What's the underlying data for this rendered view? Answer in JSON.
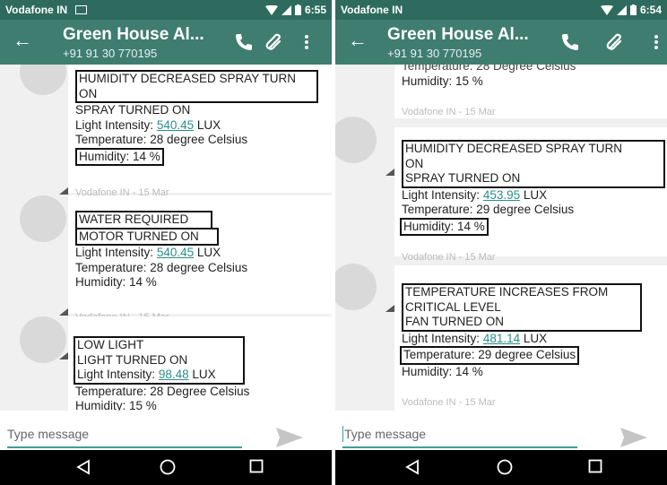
{
  "left": {
    "status": {
      "carrier": "Vodafone IN",
      "time": "6:55"
    },
    "appbar": {
      "title": "Green House Al...",
      "subtitle": "+91 91 30 770195"
    },
    "messages": [
      {
        "alert": [
          "HUMIDITY DECREASED SPRAY TURN",
          "ON"
        ],
        "lines": [
          "SPRAY TURNED ON"
        ],
        "light_value": "540.45",
        "temperature": "Temperature: 28 degree Celsius",
        "humidity": "Humidity: 14 %",
        "time": "Vodafone IN - 15 Mar"
      },
      {
        "alert": [
          "WATER REQUIRED",
          "MOTOR TURNED ON"
        ],
        "light_value": "540.45",
        "temperature": "Temperature: 28 degree Celsius",
        "humidity": "Humidity: 14 %",
        "time": "Vodafone IN - 15 Mar"
      },
      {
        "alert": [
          "LOW LIGHT",
          "LIGHT TURNED ON"
        ],
        "light_value": "98.48",
        "temperature": "Temperature: 28 Degree Celsius",
        "humidity": "Humidity: 15 %"
      }
    ],
    "compose_placeholder": "Type message"
  },
  "right": {
    "status": {
      "carrier": "Vodafone IN",
      "time": "6:54"
    },
    "appbar": {
      "title": "Green House Al...",
      "subtitle": "+91 91 30 770195"
    },
    "partial": {
      "temperature": "Temperature: 28 Degree Celsius",
      "humidity": "Humidity: 15 %",
      "time": "Vodafone IN - 15 Mar"
    },
    "messages": [
      {
        "alert": [
          "HUMIDITY DECREASED SPRAY TURN",
          "ON"
        ],
        "lines": [
          "SPRAY TURNED ON"
        ],
        "light_value": "453.95",
        "temperature": "Temperature: 29 degree Celsius",
        "humidity": "Humidity: 14 %",
        "time": "Vodafone IN - 15 Mar"
      },
      {
        "alert": [
          "TEMPERATURE INCREASES FROM",
          "CRITICAL LEVEL",
          "FAN TURNED ON"
        ],
        "light_value": "481.14",
        "temperature": "Temperature: 29 degree Celsius",
        "humidity": "Humidity: 14 %",
        "time": "Vodafone IN - 15 Mar"
      }
    ],
    "compose_placeholder": "Type message"
  },
  "labels": {
    "light_prefix": "Light Intensity: ",
    "light_unit": " LUX"
  },
  "icons": {
    "status": [
      "sim-icon",
      "wifi-icon",
      "signal-icon",
      "battery-icon"
    ],
    "appbar": [
      "back-arrow-icon",
      "phone-icon",
      "attachment-icon",
      "more-vert-icon"
    ],
    "compose": [
      "send-icon"
    ],
    "nav": [
      "nav-back-icon",
      "nav-home-icon",
      "nav-recents-icon"
    ]
  },
  "colors": {
    "status_bar": "#2e6b5e",
    "app_bar": "#3f7d70",
    "link": "#2a8f88",
    "list_bg": "#f0f0f0"
  }
}
